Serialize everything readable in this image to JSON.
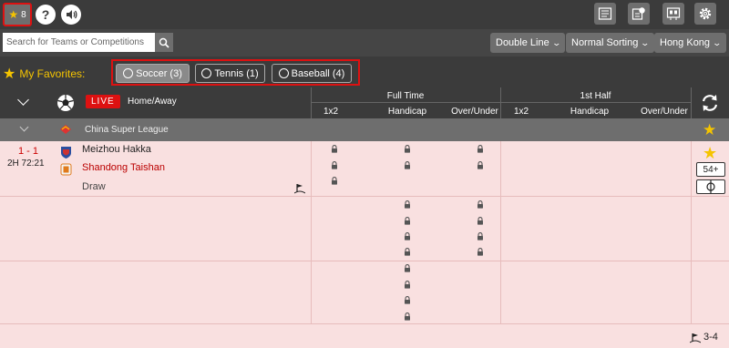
{
  "toolbar": {
    "favorites_count": "8",
    "help_symbol": "?",
    "icons": [
      "star-icon",
      "help-icon",
      "sound-icon",
      "news-icon",
      "statistics-icon",
      "scoreboard-icon",
      "settings-icon"
    ]
  },
  "search": {
    "placeholder": "Search for Teams or Competitions"
  },
  "dropdowns": {
    "line": "Double Line",
    "sorting": "Normal Sorting",
    "odds": "Hong Kong"
  },
  "favorites": {
    "label": "My Favorites:",
    "tabs": [
      {
        "label": "Soccer (3)",
        "active": true
      },
      {
        "label": "Tennis (1)",
        "active": false
      },
      {
        "label": "Baseball (4)",
        "active": false
      }
    ]
  },
  "header": {
    "live": "LIVE",
    "home_away": "Home/Away",
    "full_time": "Full Time",
    "first_half": "1st Half",
    "cols_full": [
      "1x2",
      "Handicap",
      "Over/Under"
    ],
    "cols_half": [
      "1x2",
      "Handicap",
      "Over/Under"
    ]
  },
  "league": {
    "name": "China Super League"
  },
  "match": {
    "score": "1 - 1",
    "time": "2H 72:21",
    "home": "Meizhou Hakka",
    "away": "Shandong Taishan",
    "draw": "Draw",
    "more_markets": "54+",
    "corners": "3-4"
  },
  "colors": {
    "accent_red": "#dd1111",
    "favorite_yellow": "#f5c400",
    "row_bg": "#f9e0e0",
    "dark_bar": "#3b3b3b"
  }
}
